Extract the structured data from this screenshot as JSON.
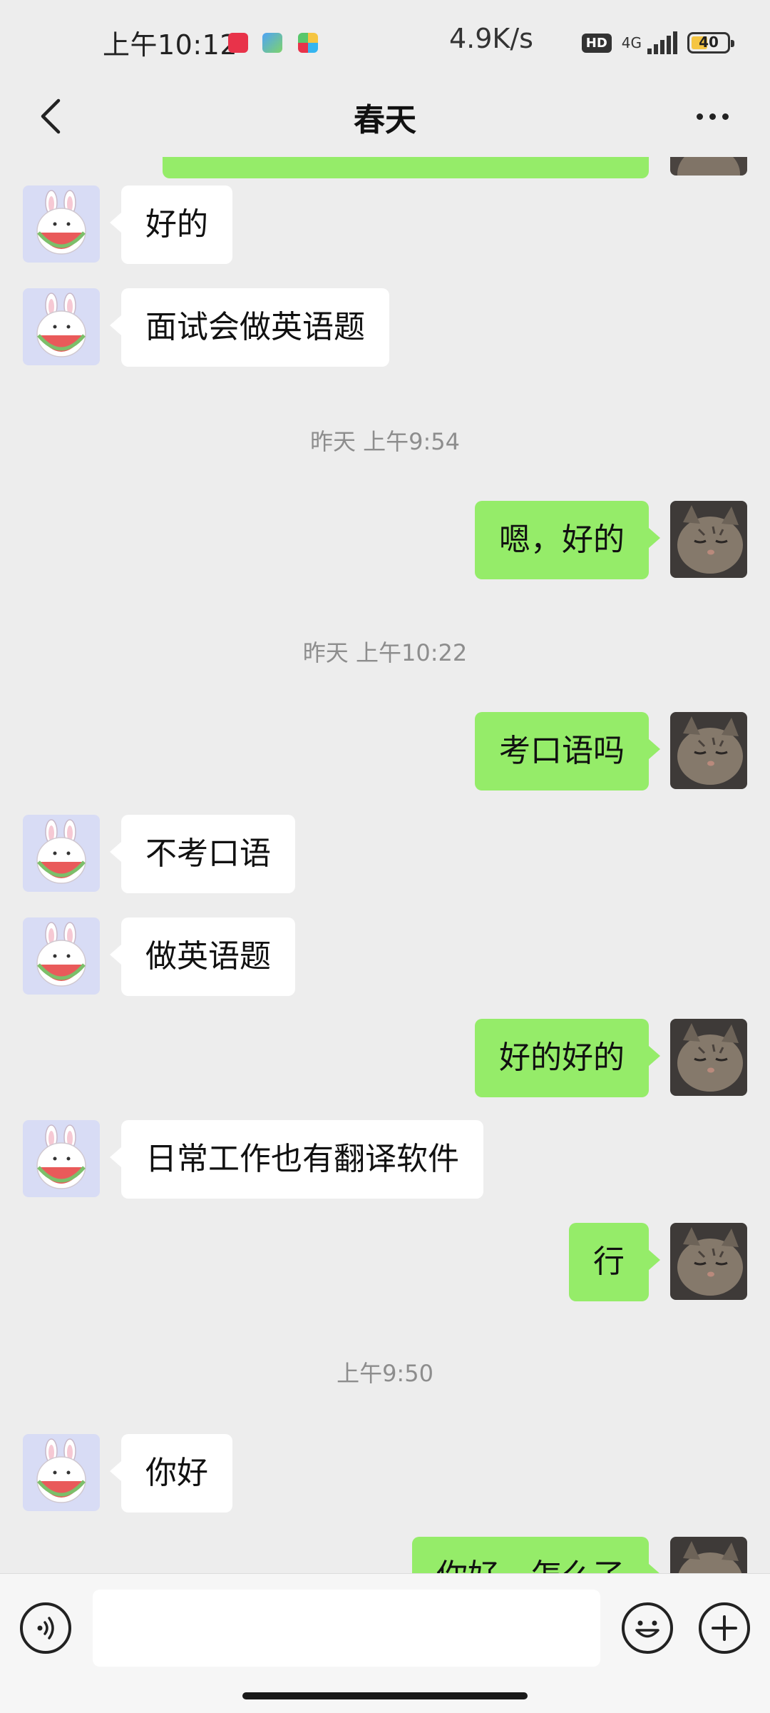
{
  "status_bar": {
    "time": "上午10:12",
    "net_speed": "4.9K/s",
    "hd_label": "HD",
    "network_label": "4G",
    "battery_level": "40",
    "battery_fraction": 0.4
  },
  "header": {
    "title": "春天",
    "back_icon": "chevron-left-icon",
    "more_icon": "ellipsis-icon"
  },
  "messages": {
    "m1": "好的",
    "m2": "面试会做英语题",
    "t1": "昨天 上午9:54",
    "m3": "嗯，好的",
    "t2": "昨天 上午10:22",
    "m4": "考口语吗",
    "m5": "不考口语",
    "m6": "做英语题",
    "m7": "好的好的",
    "m8": "日常工作也有翻译软件",
    "m9": "行",
    "t3": "上午9:50",
    "m10": "你好",
    "m11": "你好，怎么了"
  },
  "input_bar": {
    "voice_icon": "voice-icon",
    "emoji_icon": "emoji-icon",
    "plus_icon": "plus-icon",
    "input_value": ""
  },
  "colors": {
    "background": "#ededed",
    "bubble_outgoing": "#95ec69",
    "bubble_incoming": "#ffffff",
    "timestamp_text": "#8d8d8d"
  }
}
